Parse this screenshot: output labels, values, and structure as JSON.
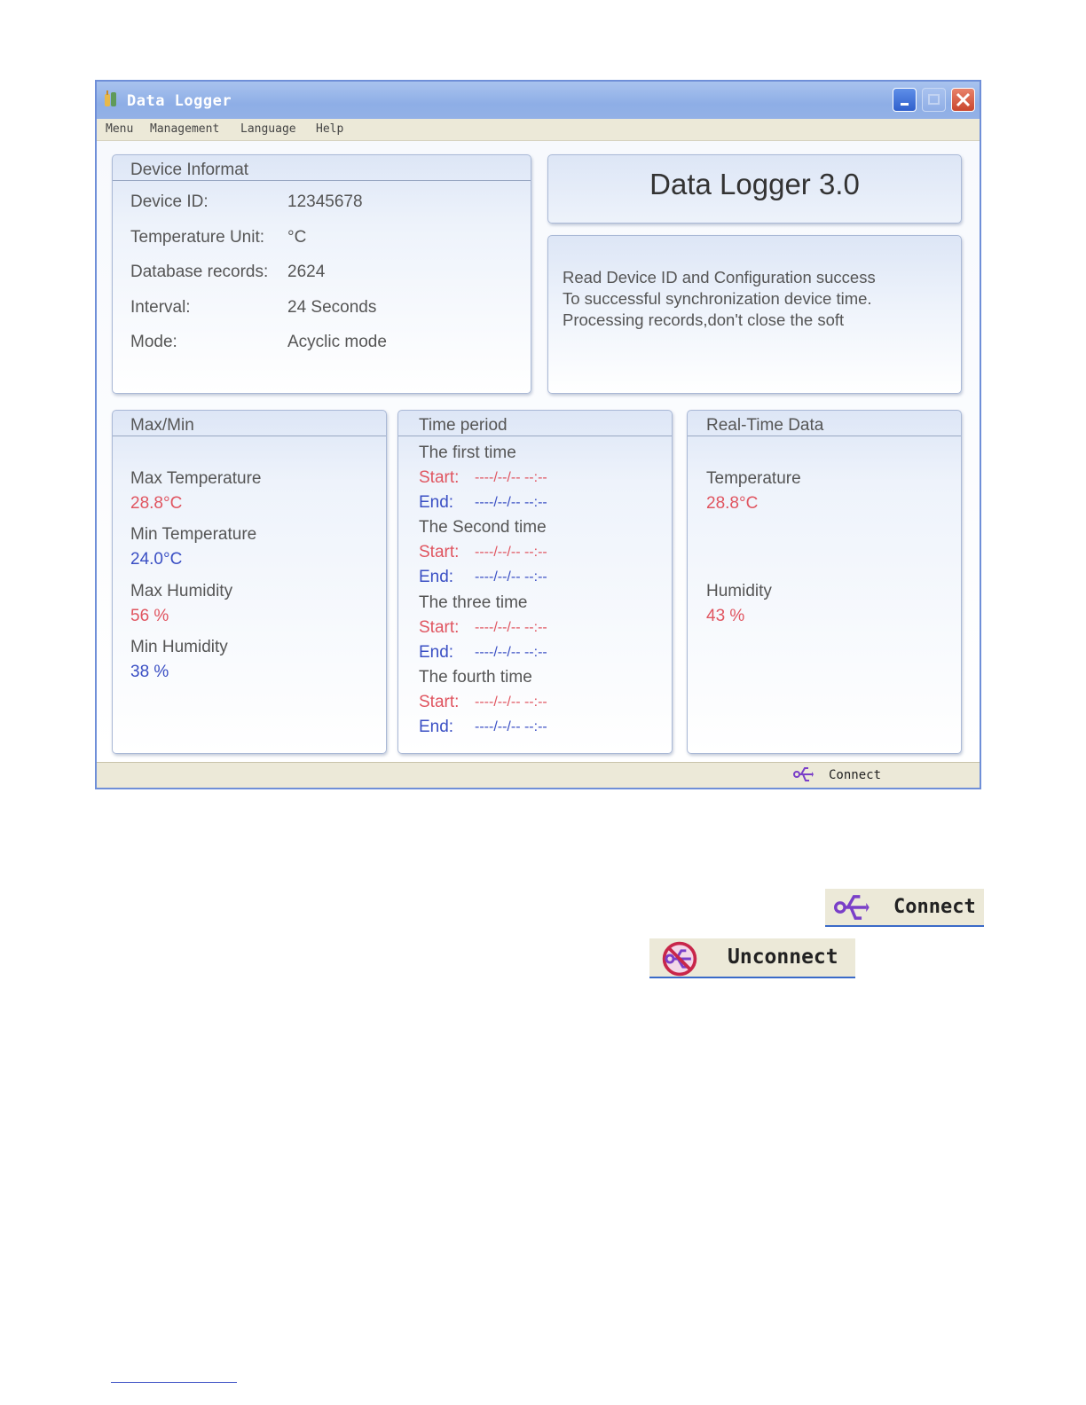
{
  "window": {
    "title": "Data Logger",
    "buttons": [
      "minimize",
      "maximize",
      "close"
    ]
  },
  "menubar": {
    "items": [
      "Menu",
      "Management",
      "Language",
      "Help"
    ]
  },
  "device_info": {
    "title": "Device Informat",
    "rows": [
      {
        "label": "Device ID:",
        "value": "12345678"
      },
      {
        "label": "Temperature Unit:",
        "value": "°C"
      },
      {
        "label": "Database records:",
        "value": "2624"
      },
      {
        "label": "Interval:",
        "value": "24 Seconds"
      },
      {
        "label": "Mode:",
        "value": "Acyclic mode"
      }
    ]
  },
  "app_title": "Data Logger 3.0",
  "messages": [
    "Read Device ID and Configuration success",
    "To successful synchronization device time.",
    "Processing records,don't close the soft"
  ],
  "maxmin": {
    "title": "Max/Min",
    "items": [
      {
        "label": "Max Temperature",
        "value": "28.8°C",
        "color": "#e05560"
      },
      {
        "label": "Min Temperature",
        "value": "24.0°C",
        "color": "#3a4fc4"
      },
      {
        "label": "Max Humidity",
        "value": "56 %",
        "color": "#e05560"
      },
      {
        "label": "Min Humidity",
        "value": "38 %",
        "color": "#3a4fc4"
      }
    ]
  },
  "time_period": {
    "title": "Time period",
    "periods": [
      {
        "name": "The first time",
        "start_label": "Start:",
        "start_value": "----/--/--  --:--",
        "end_label": "End:",
        "end_value": "----/--/--  --:--"
      },
      {
        "name": "The Second time",
        "start_label": "Start:",
        "start_value": "----/--/--  --:--",
        "end_label": "End:",
        "end_value": "----/--/--  --:--"
      },
      {
        "name": "The three time",
        "start_label": "Start:",
        "start_value": "----/--/--  --:--",
        "end_label": "End:",
        "end_value": "----/--/--  --:--"
      },
      {
        "name": "The fourth time",
        "start_label": "Start:",
        "start_value": "----/--/--  --:--",
        "end_label": "End:",
        "end_value": "----/--/--  --:--"
      }
    ]
  },
  "realtime": {
    "title": "Real-Time Data",
    "temperature_label": "Temperature",
    "temperature_value": "28.8°C",
    "humidity_label": "Humidity",
    "humidity_value": "43 %"
  },
  "statusbar": {
    "icon": "usb-icon",
    "text": "Connect"
  },
  "legend": {
    "connect": {
      "icon": "usb-icon",
      "text": "Connect"
    },
    "unconnect": {
      "icon": "usb-disconnected-icon",
      "text": "Unconnect"
    }
  },
  "colors": {
    "start_red": "#e05560",
    "end_blue": "#3a4fc4",
    "title_bar": "#8eaee6"
  }
}
